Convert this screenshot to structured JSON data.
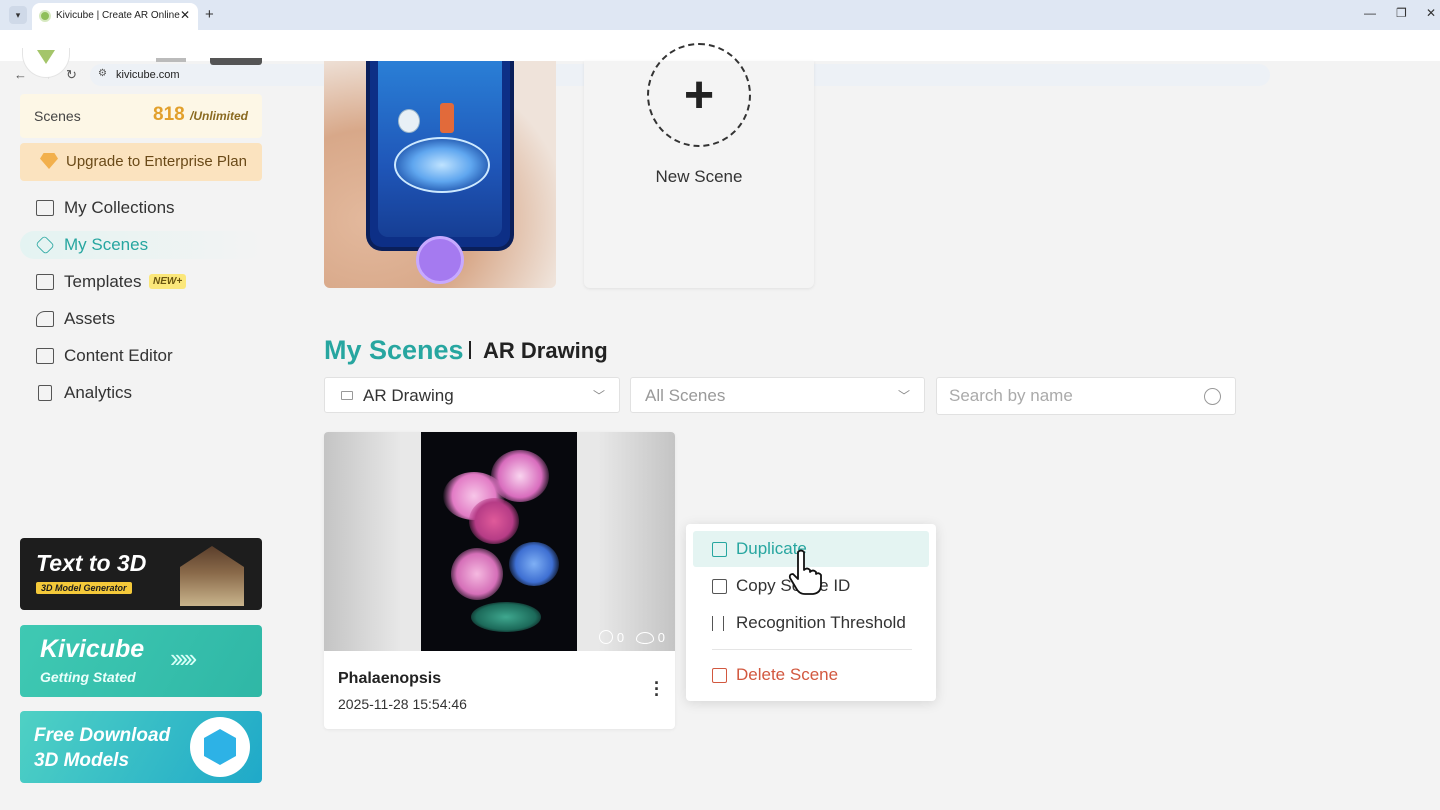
{
  "browser": {
    "tab_title": "Kivicube | Create AR Online -",
    "url": "kivicube.com"
  },
  "sidebar": {
    "scenes_label": "Scenes",
    "scenes_count": "818",
    "scenes_limit": "/Unlimited",
    "upgrade_label": "Upgrade to Enterprise Plan",
    "nav": [
      {
        "label": "My Collections"
      },
      {
        "label": "My Scenes"
      },
      {
        "label": "Templates",
        "badge": "NEW+"
      },
      {
        "label": "Assets"
      },
      {
        "label": "Content Editor"
      },
      {
        "label": "Analytics"
      }
    ],
    "banners": {
      "text_to_3d_title": "Text to 3D",
      "text_to_3d_sub": "3D Model Generator",
      "kivicube_title": "Kivicube",
      "kivicube_sub": "Getting Stated",
      "download_line1": "Free Download",
      "download_line2": "3D Models"
    }
  },
  "main": {
    "new_scene_label": "New Scene",
    "heading_main": "My Scenes",
    "heading_sub": "AR Drawing",
    "filters": {
      "collection_value": "AR Drawing",
      "scope_value": "All Scenes",
      "search_placeholder": "Search by name"
    },
    "scene": {
      "name": "Phalaenopsis",
      "date": "2025-11-28 15:54:46",
      "users": "0",
      "views": "0"
    },
    "context_menu": [
      {
        "label": "Duplicate"
      },
      {
        "label": "Copy Scene ID"
      },
      {
        "label": "Recognition Threshold"
      },
      {
        "label": "Delete Scene"
      }
    ]
  }
}
